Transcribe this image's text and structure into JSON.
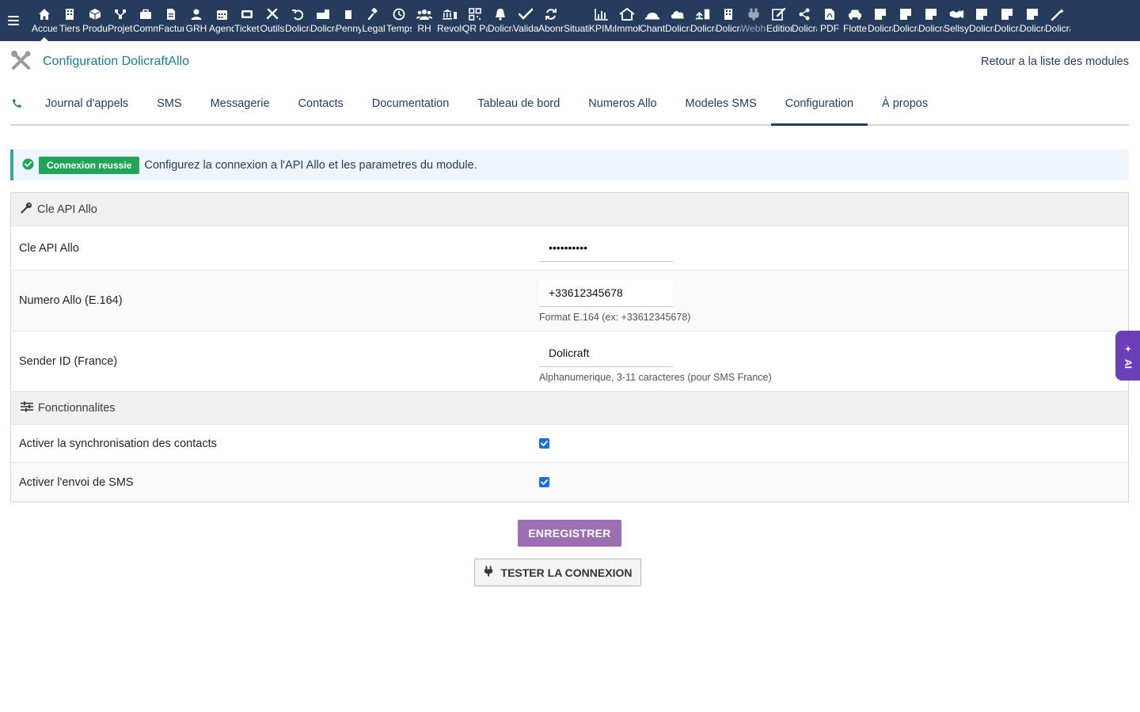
{
  "nav": {
    "items": [
      {
        "label": "Accueil",
        "icon": "home-icon"
      },
      {
        "label": "Tiers",
        "icon": "building-icon"
      },
      {
        "label": "Produits",
        "icon": "cube-icon"
      },
      {
        "label": "Projets",
        "icon": "project-icon"
      },
      {
        "label": "Commercial",
        "icon": "briefcase-icon"
      },
      {
        "label": "Facturation",
        "icon": "invoice-icon"
      },
      {
        "label": "GRH",
        "icon": "user-icon"
      },
      {
        "label": "Agenda",
        "icon": "calendar-icon"
      },
      {
        "label": "Tickets",
        "icon": "ticket-icon"
      },
      {
        "label": "Outils",
        "icon": "tools-icon"
      },
      {
        "label": "Dolicraft",
        "icon": "undo-icon"
      },
      {
        "label": "Dolicraft",
        "icon": "briefcase-doc-icon"
      },
      {
        "label": "Penny",
        "icon": "card-icon"
      },
      {
        "label": "Legal",
        "icon": "gavel-icon"
      },
      {
        "label": "Temps",
        "icon": "clock-icon"
      },
      {
        "label": "RH",
        "icon": "users-icon"
      },
      {
        "label": "Revolut",
        "icon": "bank-icon"
      },
      {
        "label": "QR Pay",
        "icon": "qr-icon"
      },
      {
        "label": "Dolicraft",
        "icon": "bell-icon"
      },
      {
        "label": "Validation",
        "icon": "check-double-icon"
      },
      {
        "label": "Abonnements",
        "icon": "refresh-icon"
      },
      {
        "label": "Situation",
        "icon": "none"
      },
      {
        "label": "KPIMaster",
        "icon": "chart-icon"
      },
      {
        "label": "Immobilier",
        "icon": "house-icon"
      },
      {
        "label": "Chantiers",
        "icon": "helmet-icon"
      },
      {
        "label": "Dolicraft",
        "icon": "cloud-icon"
      },
      {
        "label": "Dolicraft",
        "icon": "upload-icon"
      },
      {
        "label": "Dolicraft",
        "icon": "building-icon"
      },
      {
        "label": "Webhooks",
        "icon": "plug-icon"
      },
      {
        "label": "Edition",
        "icon": "edit-icon"
      },
      {
        "label": "Dolicraft",
        "icon": "share-icon"
      },
      {
        "label": "PDF",
        "icon": "pdf-icon"
      },
      {
        "label": "Flotte",
        "icon": "car-icon"
      },
      {
        "label": "Dolicraft",
        "icon": "note-icon"
      },
      {
        "label": "Dolicraft",
        "icon": "note-icon"
      },
      {
        "label": "Dolicraft",
        "icon": "note-icon"
      },
      {
        "label": "Sellsy",
        "icon": "handshake-icon"
      },
      {
        "label": "Dolicraft",
        "icon": "note-icon"
      },
      {
        "label": "Dolicraft",
        "icon": "note-icon"
      },
      {
        "label": "Dolicraft",
        "icon": "note-icon"
      },
      {
        "label": "Dolicraft",
        "icon": "magic-icon"
      }
    ]
  },
  "header": {
    "title": "Configuration DolicraftAllo",
    "back_link": "Retour a la liste des modules"
  },
  "tabs": [
    {
      "label": "Journal d'appels"
    },
    {
      "label": "SMS"
    },
    {
      "label": "Messagerie"
    },
    {
      "label": "Contacts"
    },
    {
      "label": "Documentation"
    },
    {
      "label": "Tableau de bord"
    },
    {
      "label": "Numeros Allo"
    },
    {
      "label": "Modeles SMS"
    },
    {
      "label": "Configuration"
    },
    {
      "label": "À propos"
    }
  ],
  "banner": {
    "badge": "Connexion reussie",
    "text": "Configurez la connexion a l'API Allo et les parametres du module."
  },
  "form": {
    "section_api": "Cle API Allo",
    "api_key_label": "Cle API Allo",
    "api_key_value": "••••••••••",
    "number_label": "Numero Allo (E.164)",
    "number_value": "+33612345678",
    "number_hint": "Format E.164 (ex: +33612345678)",
    "sender_label": "Sender ID (France)",
    "sender_value": "Dolicraft",
    "sender_hint": "Alphanumerique, 3-11 caracteres (pour SMS France)",
    "section_features": "Fonctionnalites",
    "sync_contacts_label": "Activer la synchronisation des contacts",
    "sync_contacts_checked": true,
    "send_sms_label": "Activer l'envoi de SMS",
    "send_sms_checked": true
  },
  "buttons": {
    "save": "ENREGISTRER",
    "test": "TESTER LA CONNEXION"
  },
  "ai_tab": {
    "label": "AI"
  },
  "colors": {
    "topbar": "#263c5c",
    "title": "#1f7a8c",
    "badge": "#23a357",
    "save_button": "#9b6fb1",
    "ai_tab": "#6a3fb8",
    "checkbox": "#1a6fe0"
  }
}
